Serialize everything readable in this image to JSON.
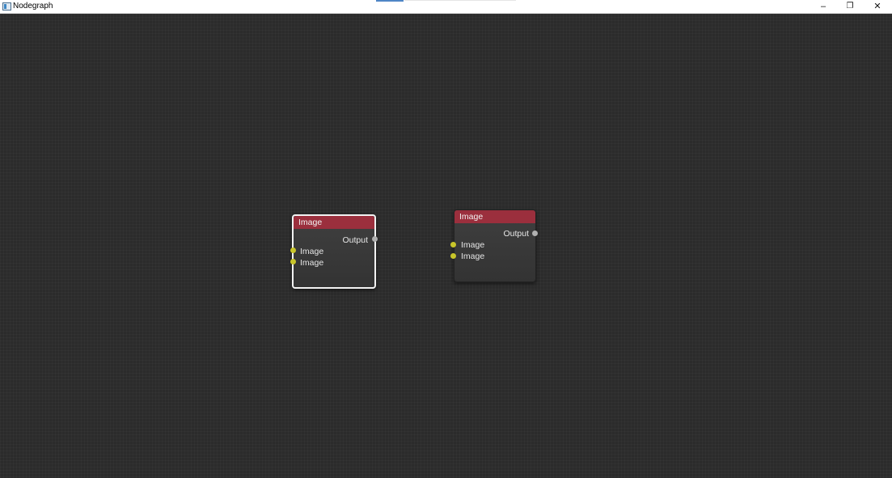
{
  "window": {
    "title": "Nodegraph",
    "controls": {
      "minimize": "–",
      "restore": "❐",
      "close": "✕"
    }
  },
  "nodes": [
    {
      "title": "Image",
      "selected": true,
      "output": "Output",
      "inputs": [
        "Image",
        "Image"
      ]
    },
    {
      "title": "Image",
      "selected": false,
      "output": "Output",
      "inputs": [
        "Image",
        "Image"
      ]
    }
  ],
  "colors": {
    "header": "#9b2f3d",
    "input_port": "#c9c62a",
    "output_port": "#b0b0b0",
    "canvas": "#2b2b2b"
  }
}
